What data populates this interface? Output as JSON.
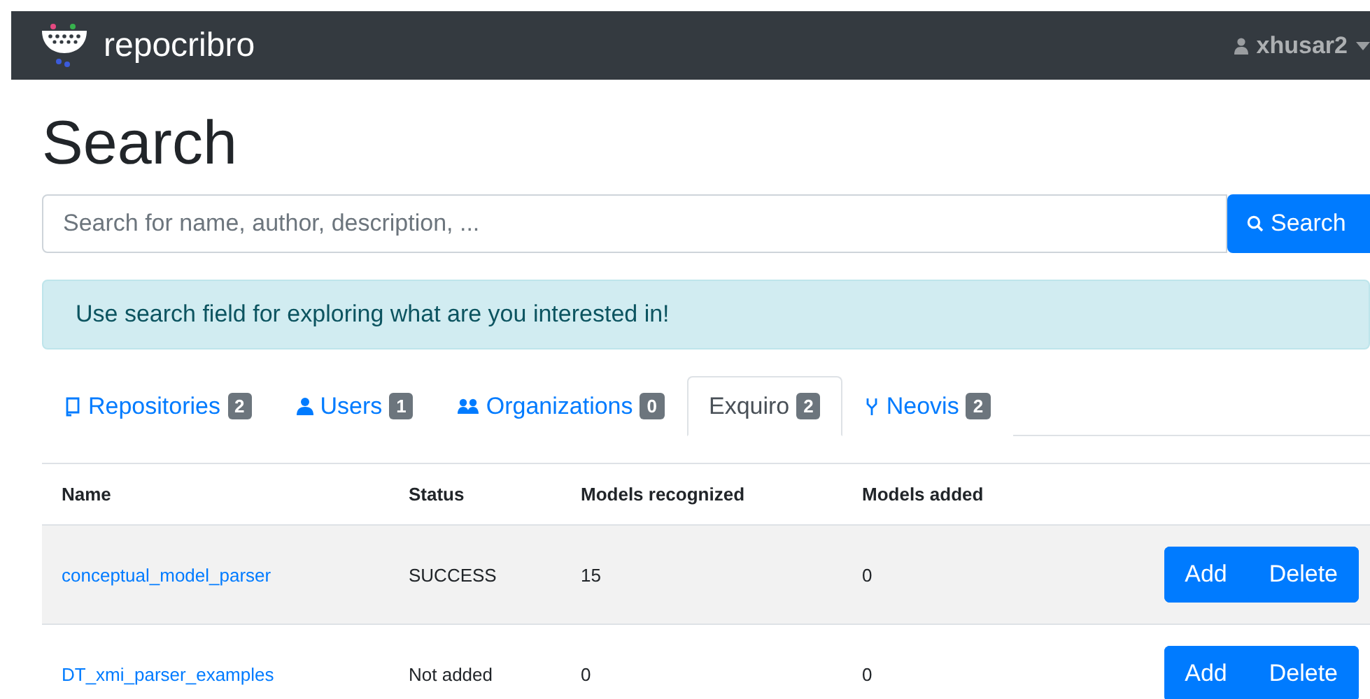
{
  "navbar": {
    "brand": "repocribro",
    "user": "xhusar2"
  },
  "title": "Search",
  "search": {
    "placeholder": "Search for name, author, description, ...",
    "button": "Search"
  },
  "alert": "Use search field for exploring what are you interested in!",
  "tabs": [
    {
      "kind": "repo",
      "label": "Repositories",
      "count": "2",
      "selected": false
    },
    {
      "kind": "user",
      "label": "Users",
      "count": "1",
      "selected": false
    },
    {
      "kind": "org",
      "label": "Organizations",
      "count": "0",
      "selected": false
    },
    {
      "kind": "none",
      "label": "Exquiro",
      "count": "2",
      "selected": true
    },
    {
      "kind": "fork",
      "label": "Neovis",
      "count": "2",
      "selected": false
    }
  ],
  "table": {
    "columns": [
      "Name",
      "Status",
      "Models recognized",
      "Models added"
    ],
    "rows": [
      {
        "name": "conceptual_model_parser",
        "status": "SUCCESS",
        "recognized": "15",
        "added": "0",
        "selected": true,
        "actions": [
          "Add",
          "Delete"
        ]
      },
      {
        "name": "DT_xmi_parser_examples",
        "status": "Not added",
        "recognized": "0",
        "added": "0",
        "selected": false,
        "actions": [
          "Add",
          "Delete"
        ]
      }
    ]
  }
}
